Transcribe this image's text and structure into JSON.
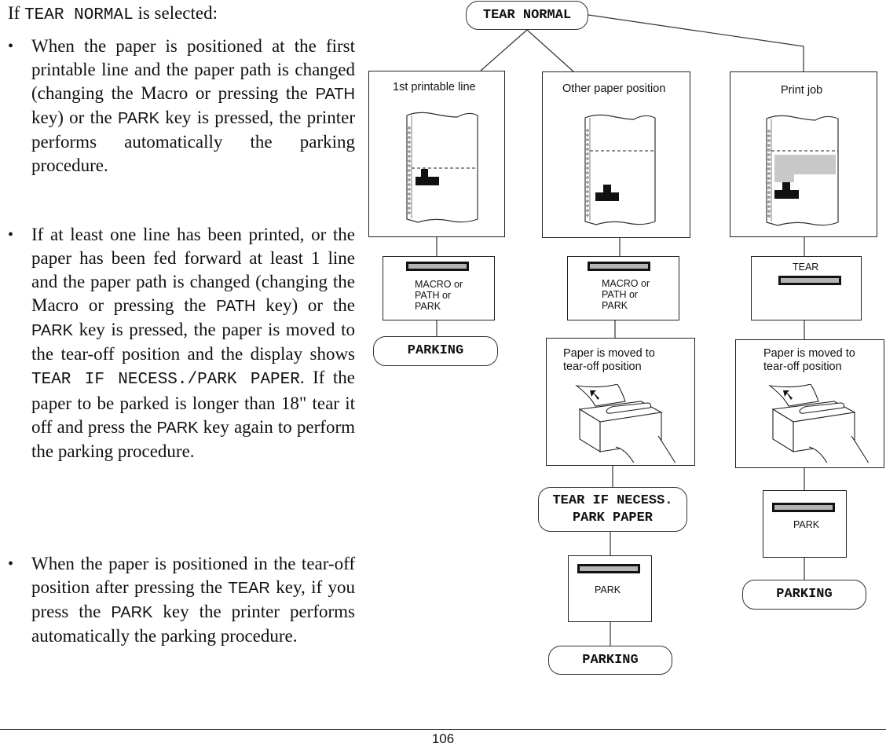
{
  "text": {
    "intro_prefix": "If ",
    "intro_code": "TEAR NORMAL",
    "intro_suffix": " is selected:",
    "bullet_glyph": "•",
    "bullet1": {
      "p1": "When the paper is positioned at the first printable line and the paper path is changed (changing the Macro or pressing the ",
      "key1": "PATH",
      "p2": " key) or the ",
      "key2": "PARK",
      "p3": " key is pressed, the printer performs automatically the parking procedure."
    },
    "bullet2": {
      "p1": "If at least one line has been printed, or the paper has been fed forward at least 1 line and the paper path is changed (changing the Macro or pressing the ",
      "key1": "PATH",
      "p2": " key) or the ",
      "key2": "PARK",
      "p3": " key is pressed, the paper is moved to the tear-off position and the display shows ",
      "code": "TEAR IF NECESS./PARK PAPER",
      "p4": ". If the paper to be parked is longer than 18\" tear it off and press the ",
      "key3": "PARK",
      "p5": " key again to perform the parking procedure."
    },
    "bullet3": {
      "p1": "When the paper is positioned in the tear-off position after pressing the ",
      "key1": "TEAR",
      "p2": " key, if you press the ",
      "key2": "PARK",
      "p3": " key the printer performs automatically the parking procedure."
    }
  },
  "diagram": {
    "root": "TEAR NORMAL",
    "branches": [
      {
        "title": "1st printable line",
        "key_label": [
          "MACRO or",
          "PATH or",
          "PARK"
        ],
        "result": "PARKING"
      },
      {
        "title": "Other paper position",
        "key_label": [
          "MACRO or",
          "PATH or",
          "PARK"
        ],
        "move_text": [
          "Paper is moved to",
          "tear-off position"
        ],
        "display": [
          "TEAR IF NECESS.",
          "PARK PAPER"
        ],
        "key2_label": "PARK",
        "result": "PARKING"
      },
      {
        "title": "Print job",
        "key_label": "TEAR",
        "move_text": [
          "Paper is moved to",
          "tear-off position"
        ],
        "key2_label": "PARK",
        "result": "PARKING"
      }
    ]
  },
  "footer": {
    "page_number": "106"
  }
}
